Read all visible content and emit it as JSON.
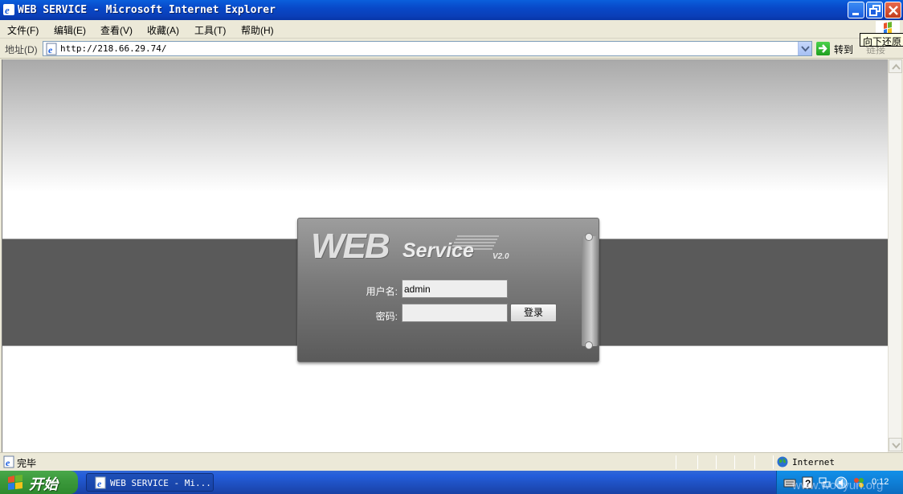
{
  "window": {
    "title": "WEB SERVICE - Microsoft Internet Explorer"
  },
  "menu": {
    "items": [
      "文件(F)",
      "编辑(E)",
      "查看(V)",
      "收藏(A)",
      "工具(T)",
      "帮助(H)"
    ]
  },
  "tooltip": "向下还原",
  "address": {
    "label": "地址(D)",
    "url": "http://218.66.29.74/",
    "go_label": "转到",
    "links_label": "链接"
  },
  "login": {
    "logo_web": "WEB",
    "logo_service": "Service",
    "logo_version": "V2.0",
    "username_label": "用户名:",
    "username_value": "admin",
    "password_label": "密码:",
    "password_value": "",
    "login_button": "登录"
  },
  "status": {
    "text": "完毕",
    "zone": "Internet"
  },
  "taskbar": {
    "start_label": "开始",
    "task_label": "WEB SERVICE - Mi...",
    "clock": "0:12"
  },
  "watermark": "www.wooyun.org",
  "colors": {
    "titlebar": "#0a4fd0",
    "band": "#5a5a5a",
    "panel": "#7a7a7a",
    "taskbar": "#245edb",
    "start": "#3c9a3c"
  }
}
